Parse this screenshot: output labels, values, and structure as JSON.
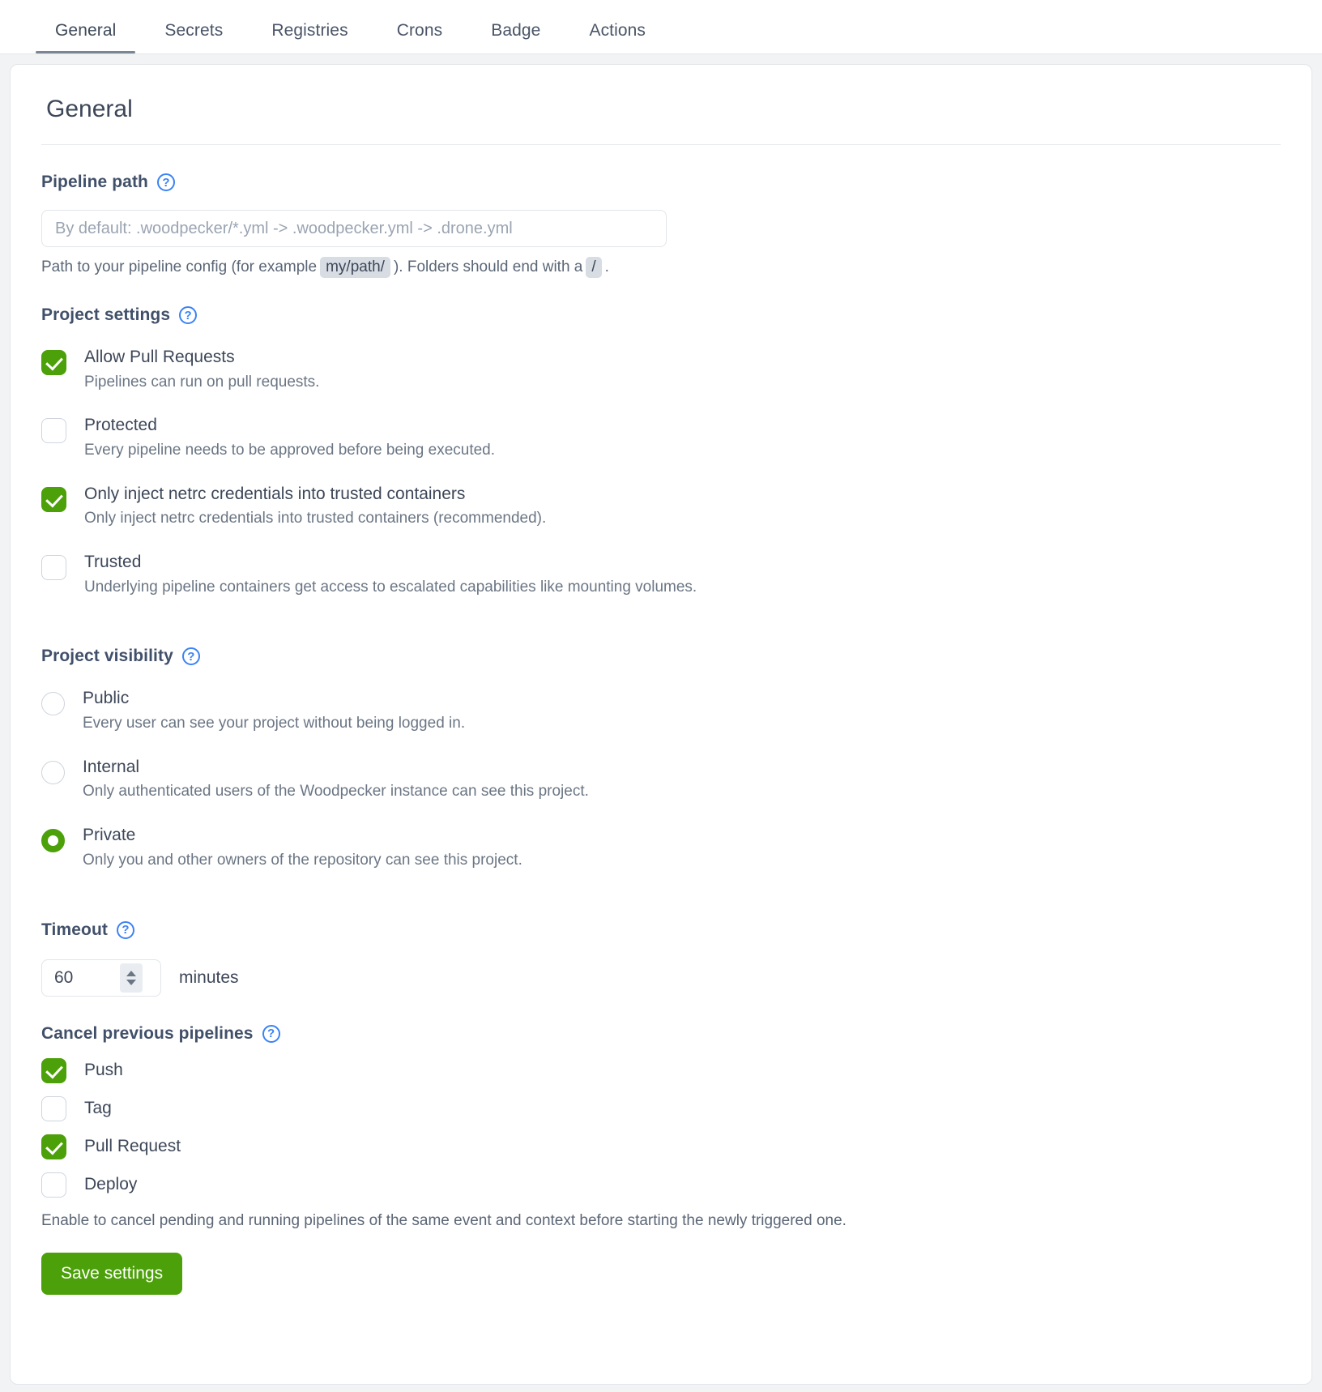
{
  "tabs": [
    {
      "label": "General",
      "active": true
    },
    {
      "label": "Secrets",
      "active": false
    },
    {
      "label": "Registries",
      "active": false
    },
    {
      "label": "Crons",
      "active": false
    },
    {
      "label": "Badge",
      "active": false
    },
    {
      "label": "Actions",
      "active": false
    }
  ],
  "card": {
    "title": "General"
  },
  "pipeline_path": {
    "heading": "Pipeline path",
    "help_icon": "?",
    "placeholder": "By default: .woodpecker/*.yml -> .woodpecker.yml -> .drone.yml",
    "value": "",
    "help_prefix": "Path to your pipeline config (for example",
    "help_chip1": "my/path/",
    "help_middle": "). Folders should end with a",
    "help_chip2": "/",
    "help_suffix": "."
  },
  "project_settings": {
    "heading": "Project settings",
    "help_icon": "?",
    "options": [
      {
        "label": "Allow Pull Requests",
        "desc": "Pipelines can run on pull requests.",
        "checked": true
      },
      {
        "label": "Protected",
        "desc": "Every pipeline needs to be approved before being executed.",
        "checked": false
      },
      {
        "label": "Only inject netrc credentials into trusted containers",
        "desc": "Only inject netrc credentials into trusted containers (recommended).",
        "checked": true
      },
      {
        "label": "Trusted",
        "desc": "Underlying pipeline containers get access to escalated capabilities like mounting volumes.",
        "checked": false
      }
    ]
  },
  "project_visibility": {
    "heading": "Project visibility",
    "help_icon": "?",
    "options": [
      {
        "label": "Public",
        "desc": "Every user can see your project without being logged in.",
        "selected": false
      },
      {
        "label": "Internal",
        "desc": "Only authenticated users of the Woodpecker instance can see this project.",
        "selected": false
      },
      {
        "label": "Private",
        "desc": "Only you and other owners of the repository can see this project.",
        "selected": true
      }
    ]
  },
  "timeout": {
    "heading": "Timeout",
    "help_icon": "?",
    "value": "60",
    "unit": "minutes"
  },
  "cancel_previous": {
    "heading": "Cancel previous pipelines",
    "help_icon": "?",
    "options": [
      {
        "label": "Push",
        "checked": true
      },
      {
        "label": "Tag",
        "checked": false
      },
      {
        "label": "Pull Request",
        "checked": true
      },
      {
        "label": "Deploy",
        "checked": false
      }
    ],
    "note": "Enable to cancel pending and running pipelines of the same event and context before starting the newly triggered one."
  },
  "actions": {
    "save_label": "Save settings"
  },
  "colors": {
    "accent_green": "#4ca009",
    "help_blue": "#3b82f6",
    "text_primary": "#3d4758",
    "text_muted": "#6b7684"
  }
}
